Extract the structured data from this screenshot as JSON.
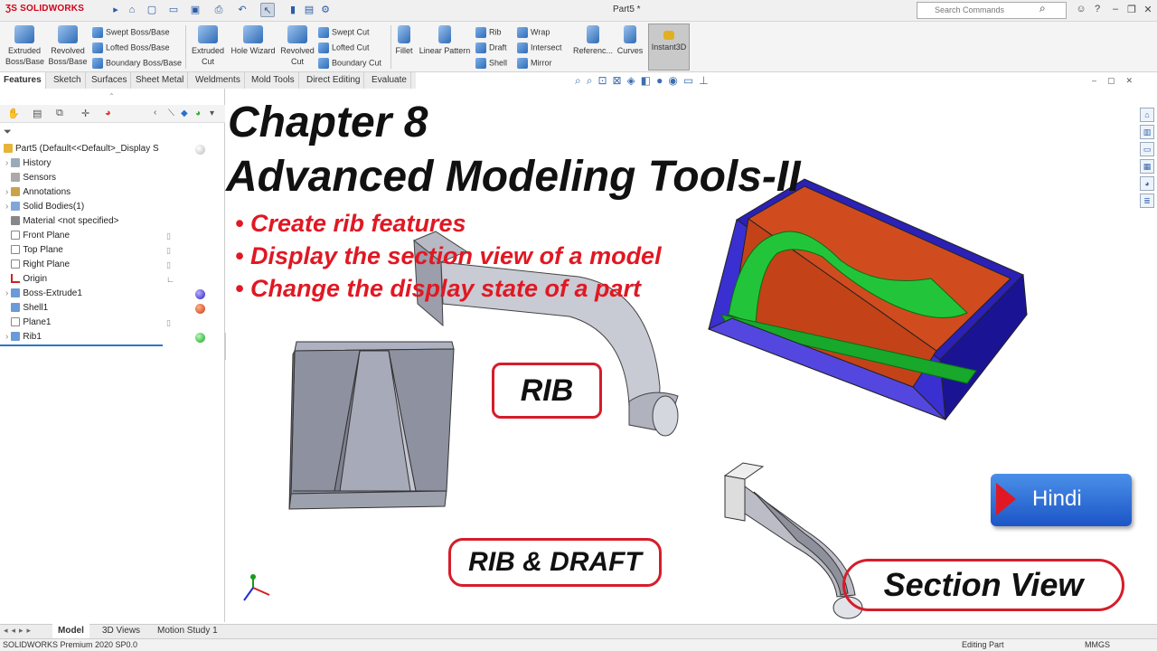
{
  "app": {
    "logo_text": "SOLIDWORKS",
    "doc_title": "Part5 *"
  },
  "search": {
    "placeholder": "Search Commands"
  },
  "ribbon": {
    "extruded_boss": "Extruded Boss/Base",
    "revolved_boss": "Revolved Boss/Base",
    "swept_boss": "Swept Boss/Base",
    "lofted_boss": "Lofted Boss/Base",
    "boundary_boss": "Boundary Boss/Base",
    "extruded_cut": "Extruded Cut",
    "hole_wizard": "Hole Wizard",
    "revolved_cut": "Revolved Cut",
    "swept_cut": "Swept Cut",
    "lofted_cut": "Lofted Cut",
    "boundary_cut": "Boundary Cut",
    "fillet": "Fillet",
    "linear_pattern": "Linear Pattern",
    "rib": "Rib",
    "draft": "Draft",
    "shell": "Shell",
    "wrap": "Wrap",
    "intersect": "Intersect",
    "mirror": "Mirror",
    "reference": "Referenc...",
    "curves": "Curves",
    "instant3d": "Instant3D"
  },
  "tabs": [
    "Features",
    "Sketch",
    "Surfaces",
    "Sheet Metal",
    "Weldments",
    "Mold Tools",
    "Direct Editing",
    "Evaluate"
  ],
  "tree": {
    "root": "Part5  (Default<<Default>_Display S",
    "items": [
      "History",
      "Sensors",
      "Annotations",
      "Solid Bodies(1)",
      "Material <not specified>",
      "Front Plane",
      "Top Plane",
      "Right Plane",
      "Origin",
      "Boss-Extrude1",
      "Shell1",
      "Plane1",
      "Rib1"
    ]
  },
  "slide": {
    "chapter": "Chapter 8",
    "title": "Advanced Modeling Tools-II",
    "bullets": [
      "• Create rib features",
      "• Display the section view of a model",
      "• Change the display state of a part"
    ],
    "callout_rib": "RIB",
    "callout_rib_draft": "RIB & DRAFT",
    "callout_section": "Section View",
    "hindi_button": "Hindi"
  },
  "bottom_tabs": [
    "Model",
    "3D Views",
    "Motion Study 1"
  ],
  "status": {
    "left": "SOLIDWORKS Premium 2020 SP0.0",
    "mode": "Editing Part",
    "units": "MMGS"
  },
  "colors": {
    "accent_red": "#e01823",
    "hindi_blue": "#2a6ad8",
    "box_blue": "#3a2dc4",
    "rib_green": "#22c53a",
    "box_floor": "#d24a1e"
  }
}
